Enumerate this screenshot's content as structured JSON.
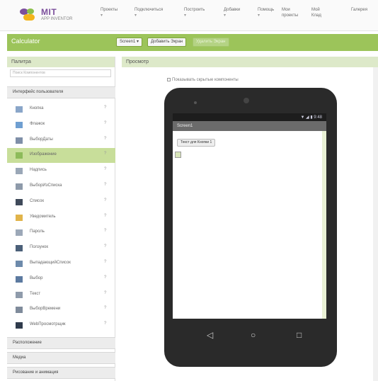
{
  "app": {
    "logo_title": "MIT",
    "logo_subtitle": "APP INVENTOR"
  },
  "topnav": [
    {
      "label": "Проекты",
      "caret": "▾"
    },
    {
      "label": "Подключиться",
      "caret": "▾"
    },
    {
      "label": "Построить",
      "caret": "▾"
    },
    {
      "label": "Добавки",
      "caret": "▾"
    },
    {
      "label": "Помощь",
      "caret": "▾"
    },
    {
      "label": "Мои проекты",
      "caret": ""
    },
    {
      "label": "Мой Клад",
      "caret": ""
    },
    {
      "label": "Галерея",
      "caret": ""
    }
  ],
  "toolbar": {
    "project_name": "Calculator",
    "screen_select": "Screen1 ▾",
    "add_screen": "Добавить Экран",
    "remove_screen": "Удалить Экран"
  },
  "palette": {
    "header": "Палитра",
    "search_placeholder": "Поиск Компонентов",
    "category_open": "Интерфейс пользователя",
    "items": [
      {
        "label": "Кнопка",
        "icon": "button-icon",
        "color": "#8aa6c9"
      },
      {
        "label": "Флажок",
        "icon": "checkbox-icon",
        "color": "#6f9fd1"
      },
      {
        "label": "ВыборДаты",
        "icon": "datepicker-icon",
        "color": "#7f8fa8"
      },
      {
        "label": "Изображение",
        "icon": "image-icon",
        "color": "#8dbb5a"
      },
      {
        "label": "Надпись",
        "icon": "label-icon",
        "color": "#9aa7b7"
      },
      {
        "label": "ВыборИзСписка",
        "icon": "listpicker-icon",
        "color": "#8e9aaa"
      },
      {
        "label": "Список",
        "icon": "listview-icon",
        "color": "#3f4a5a"
      },
      {
        "label": "Уведомитель",
        "icon": "notifier-icon",
        "color": "#e1b44a"
      },
      {
        "label": "Пароль",
        "icon": "password-icon",
        "color": "#9ca8b8"
      },
      {
        "label": "Ползунок",
        "icon": "slider-icon",
        "color": "#4b6079"
      },
      {
        "label": "ВыпадающийСписок",
        "icon": "spinner-icon",
        "color": "#6d8aab"
      },
      {
        "label": "Выбор",
        "icon": "switch-icon",
        "color": "#5c7aa0"
      },
      {
        "label": "Текст",
        "icon": "textbox-icon",
        "color": "#8f9bab"
      },
      {
        "label": "ВыборВремени",
        "icon": "timepicker-icon",
        "color": "#7f8b9b"
      },
      {
        "label": "WebПросмотрщик",
        "icon": "webviewer-icon",
        "color": "#2f3b4c"
      }
    ],
    "help_glyph": "?",
    "categories_closed": [
      "Расположение",
      "Медиа",
      "Рисование и анимация"
    ]
  },
  "viewer": {
    "header": "Просмотр",
    "preview_label": "Показывать скрытые компоненты",
    "phone": {
      "status_icons": "▼ ◢ ▮ 9:48",
      "screen_title": "Screen1",
      "button_text": "Текст для Кнопки 1",
      "nav_back": "◁",
      "nav_home": "○",
      "nav_recent": "□"
    }
  },
  "colors": {
    "accent_green": "#9cc45a",
    "panel_header": "#dde9c9",
    "selected_item": "#c8de9a",
    "phone_body": "#2a2a2a"
  }
}
